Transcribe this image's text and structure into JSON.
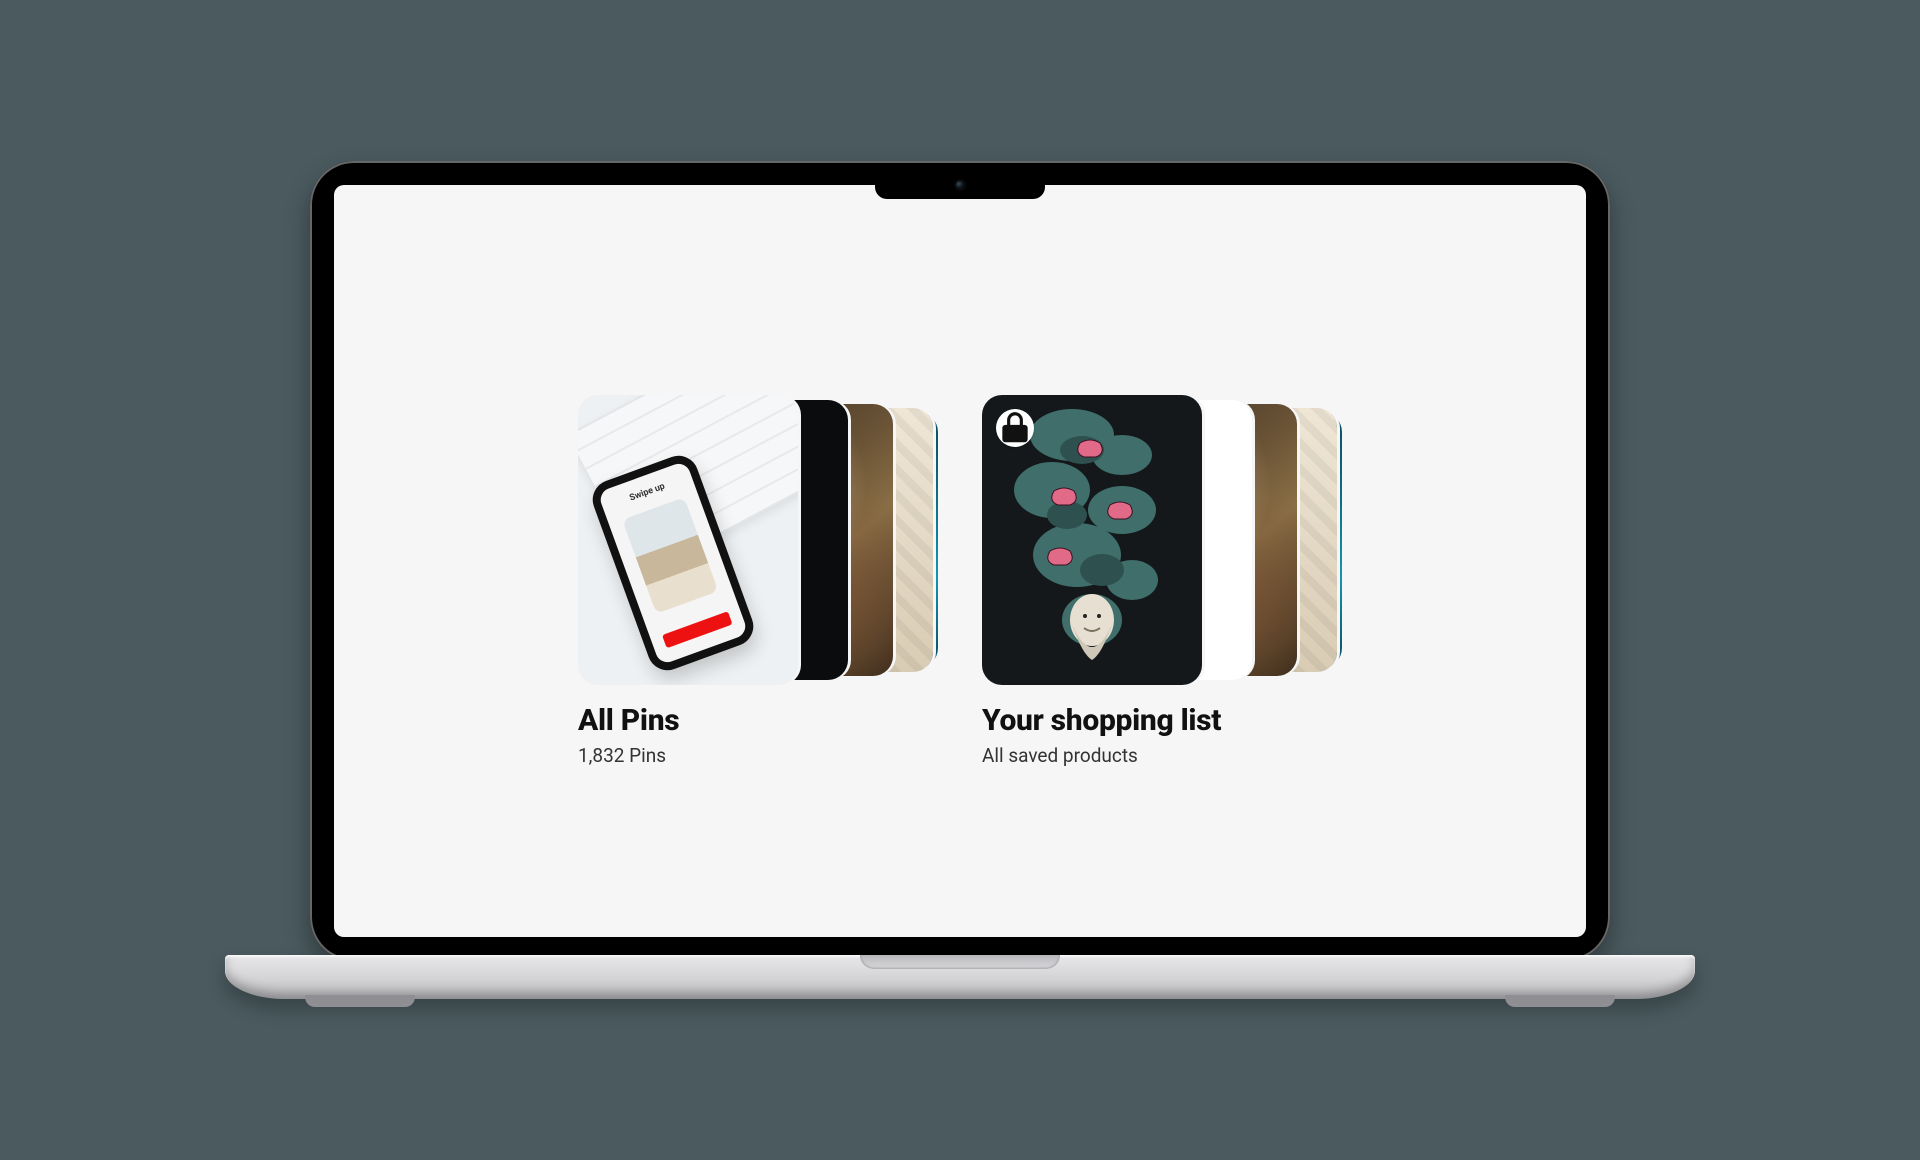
{
  "device": {
    "type": "laptop",
    "notch": true
  },
  "boards": [
    {
      "id": "all-pins",
      "title": "All Pins",
      "subtitle": "1,832 Pins",
      "locked": false,
      "thumbnails": [
        {
          "name": "phone-swipe-up-on-keyboard",
          "phone_label": "Swipe up"
        },
        {
          "name": "solid-black"
        },
        {
          "name": "classical-painting-brown"
        },
        {
          "name": "crumpled-paper-beige"
        },
        {
          "name": "ocean-wave-teal"
        }
      ]
    },
    {
      "id": "shopping-list",
      "title": "Your shopping list",
      "subtitle": "All saved products",
      "locked": true,
      "lock_icon": "lock-icon",
      "thumbnails": [
        {
          "name": "controllers-smoke-illustration-dark"
        },
        {
          "name": "ink-sketch-on-white"
        },
        {
          "name": "classical-painting-brown"
        },
        {
          "name": "crumpled-paper-beige"
        },
        {
          "name": "ocean-wave-teal"
        }
      ]
    }
  ]
}
